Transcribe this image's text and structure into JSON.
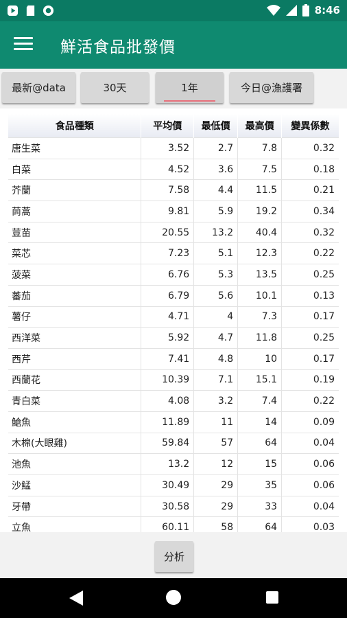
{
  "status_bar": {
    "time": "8:46",
    "icons": [
      "app-notification-icon",
      "sd-card-icon",
      "record-icon",
      "wifi-icon",
      "signal-icon",
      "battery-icon"
    ]
  },
  "app": {
    "title": "鮮活食品批發價"
  },
  "tabs": [
    {
      "label": "最新@data",
      "active": false
    },
    {
      "label": "30天",
      "active": false
    },
    {
      "label": "1年",
      "active": true
    },
    {
      "label": "今日@漁護署",
      "active": false
    }
  ],
  "table": {
    "headers": [
      "食品種類",
      "平均價",
      "最低價",
      "最高價",
      "變異係數"
    ],
    "rows": [
      [
        "唐生菜",
        "3.52",
        "2.7",
        "7.8",
        "0.32"
      ],
      [
        "白菜",
        "4.52",
        "3.6",
        "7.5",
        "0.18"
      ],
      [
        "芥蘭",
        "7.58",
        "4.4",
        "11.5",
        "0.21"
      ],
      [
        "茼蒿",
        "9.81",
        "5.9",
        "19.2",
        "0.34"
      ],
      [
        "荳苗",
        "20.55",
        "13.2",
        "40.4",
        "0.32"
      ],
      [
        "菜芯",
        "7.23",
        "5.1",
        "12.3",
        "0.22"
      ],
      [
        "菠菜",
        "6.76",
        "5.3",
        "13.5",
        "0.25"
      ],
      [
        "蕃茄",
        "6.79",
        "5.6",
        "10.1",
        "0.13"
      ],
      [
        "薯仔",
        "4.71",
        "4",
        "7.3",
        "0.17"
      ],
      [
        "西洋菜",
        "5.92",
        "4.7",
        "11.8",
        "0.25"
      ],
      [
        "西芹",
        "7.41",
        "4.8",
        "10",
        "0.17"
      ],
      [
        "西蘭花",
        "10.39",
        "7.1",
        "15.1",
        "0.19"
      ],
      [
        "青白菜",
        "4.08",
        "3.2",
        "7.4",
        "0.22"
      ],
      [
        "䱽魚",
        "11.89",
        "11",
        "14",
        "0.09"
      ],
      [
        "木棉(大眼雞)",
        "59.84",
        "57",
        "64",
        "0.04"
      ],
      [
        "池魚",
        "13.2",
        "12",
        "15",
        "0.06"
      ],
      [
        "沙鯭",
        "30.49",
        "29",
        "35",
        "0.06"
      ],
      [
        "牙帶",
        "30.58",
        "29",
        "33",
        "0.04"
      ],
      [
        "立魚",
        "60.11",
        "58",
        "64",
        "0.03"
      ]
    ]
  },
  "bottom": {
    "analyze_label": "分析"
  },
  "colors": {
    "status_bar": "#0b7a63",
    "app_bar": "#0f8a70",
    "tab_indicator": "#e8707b"
  }
}
